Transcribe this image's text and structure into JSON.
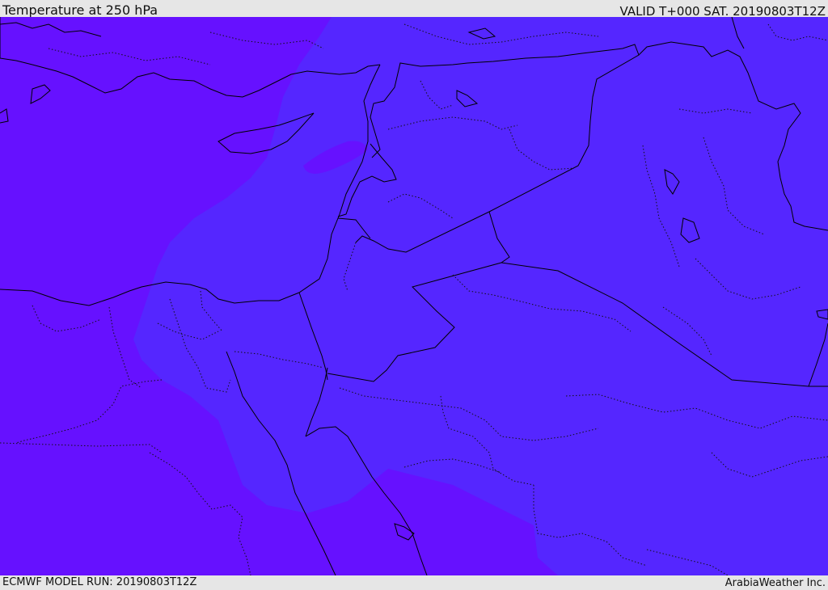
{
  "header": {
    "title": "Temperature at 250 hPa",
    "valid": "VALID T+000 SAT. 20190803T12Z"
  },
  "footer": {
    "model_run": "ECMWF MODEL RUN: 20190803T12Z",
    "credit": "ArabiaWeather Inc."
  },
  "map": {
    "field_colors": {
      "cold_band": "#6611ff",
      "warm_band": "#5526ff"
    }
  }
}
